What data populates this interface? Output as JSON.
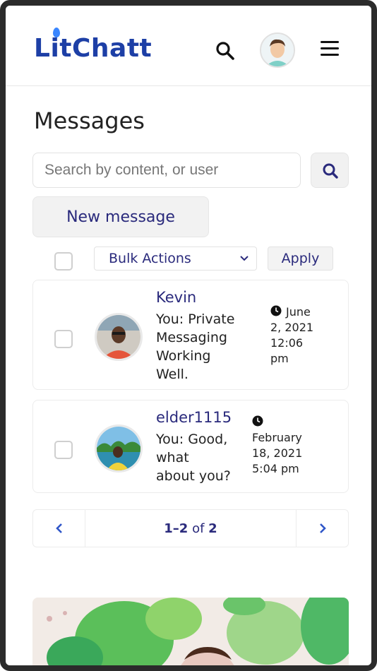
{
  "app": {
    "logo": "LitChatt"
  },
  "page": {
    "title": "Messages"
  },
  "search": {
    "placeholder": "Search by content, or user"
  },
  "actions": {
    "new_message": "New message",
    "bulk_actions": "Bulk Actions",
    "apply": "Apply"
  },
  "messages": [
    {
      "name": "Kevin",
      "preview_lines": [
        "You: Private",
        "Messaging",
        "Working",
        "Well."
      ],
      "time_lines": [
        "June",
        "2, 2021",
        "12:06",
        "pm"
      ]
    },
    {
      "name": "elder1115",
      "preview_lines": [
        "You: Good,",
        "what",
        "about you?"
      ],
      "time_lines": [
        "February",
        "18, 2021",
        "5:04 pm"
      ]
    }
  ],
  "pagination": {
    "range": "1–2",
    "of_label": "of",
    "total": "2"
  },
  "icons": {
    "header_search": "search-icon",
    "menu": "hamburger-icon",
    "clock": "clock-icon",
    "prev": "chevron-left-icon",
    "next": "chevron-right-icon",
    "dropdown": "chevron-down-icon"
  },
  "colors": {
    "brand": "#1d3fa6",
    "link": "#2a2a7c",
    "accent_blue": "#2f56c8"
  }
}
